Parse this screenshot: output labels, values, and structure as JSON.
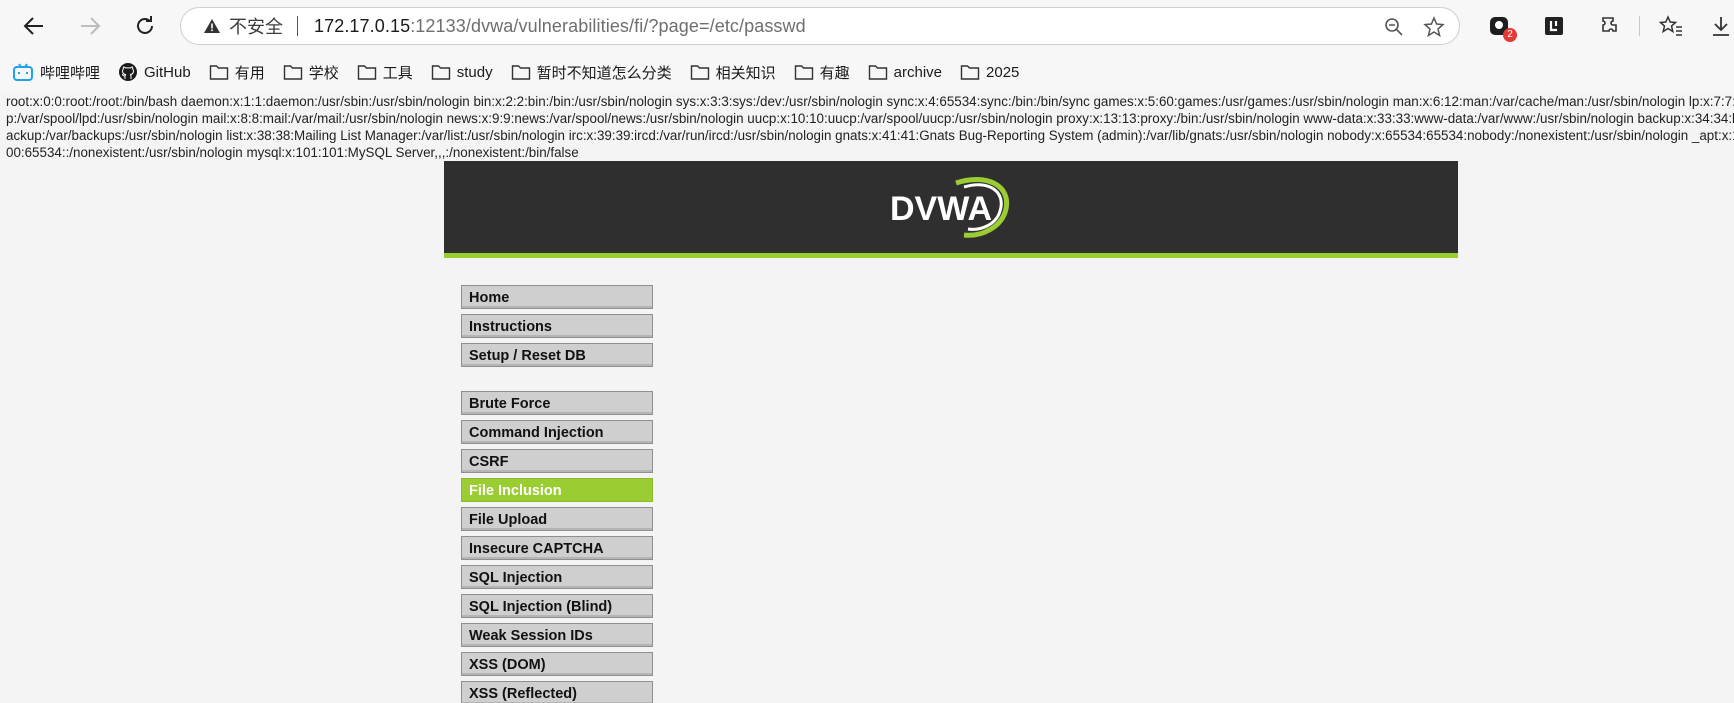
{
  "browser": {
    "security_label": "不安全",
    "url_host": "172.17.0.15",
    "url_rest": ":12133/dvwa/vulnerabilities/fi/?page=/etc/passwd",
    "extension_badge": "2",
    "icons": [
      "back-icon",
      "forward-icon",
      "reload-icon",
      "warning-icon",
      "zoom-icon",
      "star-icon",
      "extension-icon",
      "favorites-icon",
      "downloads-icon"
    ]
  },
  "bookmarks": [
    {
      "label": "哔哩哔哩",
      "icon": "bilibili-icon"
    },
    {
      "label": "GitHub",
      "icon": "github-icon"
    },
    {
      "label": "有用",
      "icon": "folder-icon"
    },
    {
      "label": "学校",
      "icon": "folder-icon"
    },
    {
      "label": "工具",
      "icon": "folder-icon"
    },
    {
      "label": "study",
      "icon": "folder-icon"
    },
    {
      "label": "暂时不知道怎么分类",
      "icon": "folder-icon"
    },
    {
      "label": "相关知识",
      "icon": "folder-icon"
    },
    {
      "label": "有趣",
      "icon": "folder-icon"
    },
    {
      "label": "archive",
      "icon": "folder-icon"
    },
    {
      "label": "2025",
      "icon": "folder-icon"
    }
  ],
  "page": {
    "leaked_passwd": "root:x:0:0:root:/root:/bin/bash daemon:x:1:1:daemon:/usr/sbin:/usr/sbin/nologin bin:x:2:2:bin:/bin:/usr/sbin/nologin sys:x:3:3:sys:/dev:/usr/sbin/nologin sync:x:4:65534:sync:/bin:/bin/sync games:x:5:60:games:/usr/games:/usr/sbin/nologin man:x:6:12:man:/var/cache/man:/usr/sbin/nologin lp:x:7:7:lp:/var/spool/lpd:/usr/sbin/nologin mail:x:8:8:mail:/var/mail:/usr/sbin/nologin news:x:9:9:news:/var/spool/news:/usr/sbin/nologin uucp:x:10:10:uucp:/var/spool/uucp:/usr/sbin/nologin proxy:x:13:13:proxy:/bin:/usr/sbin/nologin www-data:x:33:33:www-data:/var/www:/usr/sbin/nologin backup:x:34:34:backup:/var/backups:/usr/sbin/nologin list:x:38:38:Mailing List Manager:/var/list:/usr/sbin/nologin irc:x:39:39:ircd:/var/run/ircd:/usr/sbin/nologin gnats:x:41:41:Gnats Bug-Reporting System (admin):/var/lib/gnats:/usr/sbin/nologin nobody:x:65534:65534:nobody:/nonexistent:/usr/sbin/nologin _apt:x:100:65534::/nonexistent:/usr/sbin/nologin mysql:x:101:101:MySQL Server,,,:/nonexistent:/bin/false",
    "logo_text": "DVWA",
    "menu_top": [
      "Home",
      "Instructions",
      "Setup / Reset DB"
    ],
    "menu_vulns": [
      "Brute Force",
      "Command Injection",
      "CSRF",
      "File Inclusion",
      "File Upload",
      "Insecure CAPTCHA",
      "SQL Injection",
      "SQL Injection (Blind)",
      "Weak Session IDs",
      "XSS (DOM)",
      "XSS (Reflected)"
    ],
    "active_item": "File Inclusion",
    "accent_color": "#9acd32"
  }
}
